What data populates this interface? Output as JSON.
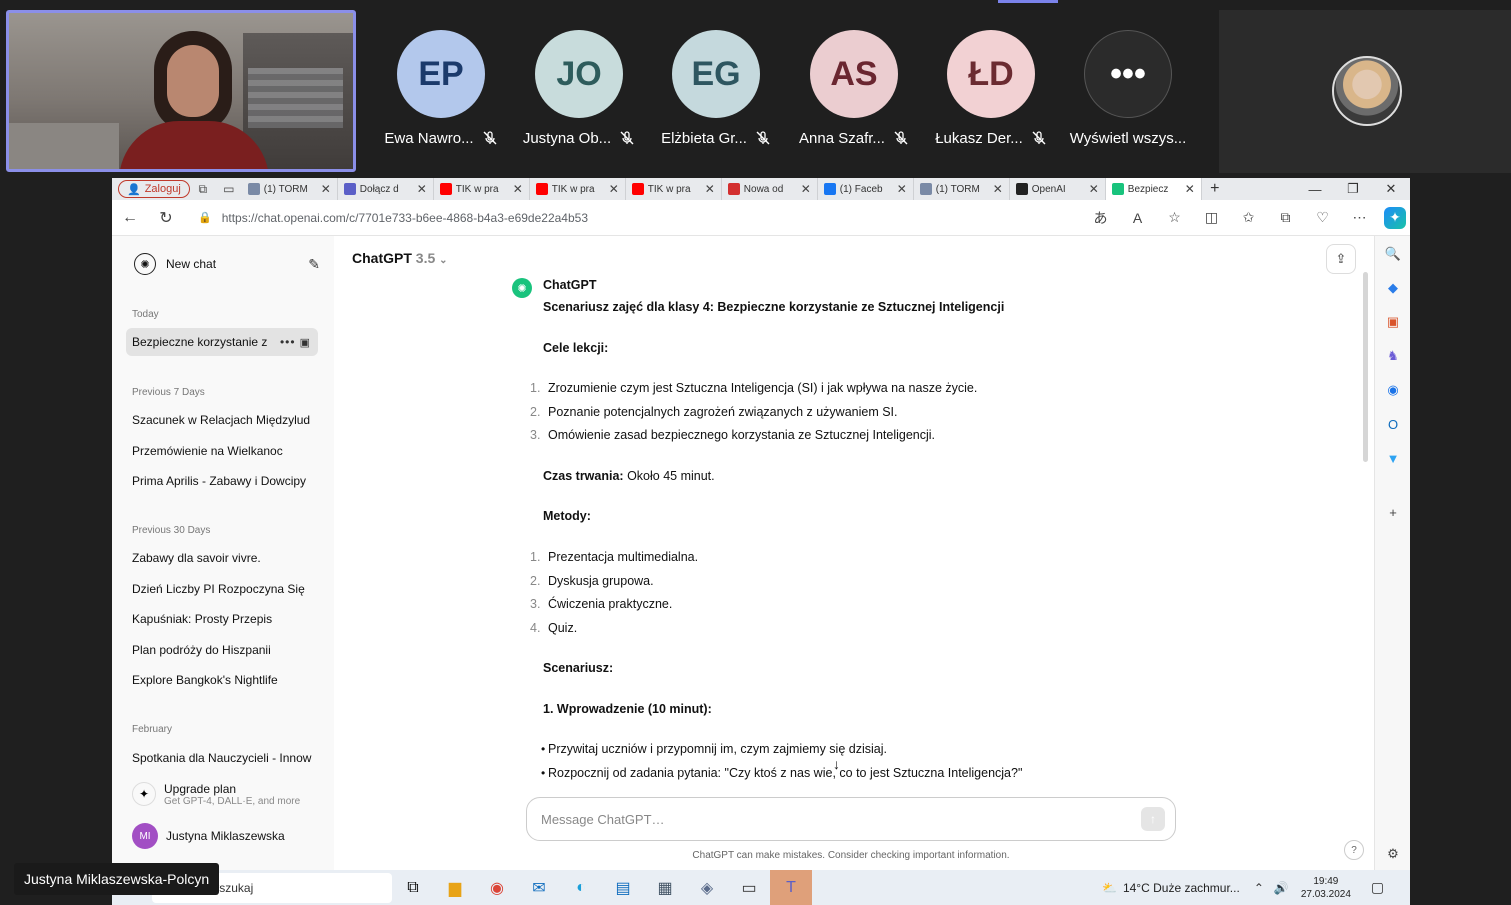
{
  "meeting": {
    "participants": [
      {
        "initials": "EP",
        "name": "Ewa Nawro...",
        "bg": "#b3c8ec",
        "fg": "#1b3a6b"
      },
      {
        "initials": "JO",
        "name": "Justyna Ob...",
        "bg": "#c8dcdc",
        "fg": "#2e5c5c"
      },
      {
        "initials": "EG",
        "name": "Elżbieta Gr...",
        "bg": "#c5d9dd",
        "fg": "#2e5660"
      },
      {
        "initials": "AS",
        "name": "Anna Szafr...",
        "bg": "#ebcdd0",
        "fg": "#6a2630"
      },
      {
        "initials": "ŁD",
        "name": "Łukasz Der...",
        "bg": "#f2d1d3",
        "fg": "#6b2b31"
      },
      {
        "initials": "•••",
        "name": "Wyświetl wszys...",
        "bg": "#2b2b2b",
        "fg": "#ffffff"
      }
    ],
    "presenter_name": "Justyna Miklaszewska-Polcyn"
  },
  "browser": {
    "login_label": "Zaloguj",
    "tabs": [
      {
        "title": "(1) TORM",
        "color": "#7a8aa6"
      },
      {
        "title": "Dołącz d",
        "color": "#5b5fc7"
      },
      {
        "title": "TIK w pra",
        "color": "#ff0000"
      },
      {
        "title": "TIK w pra",
        "color": "#ff0000"
      },
      {
        "title": "TIK w pra",
        "color": "#ff0000"
      },
      {
        "title": "Nowa od",
        "color": "#d32f2f"
      },
      {
        "title": "(1) Faceb",
        "color": "#1877f2"
      },
      {
        "title": "(1) TORM",
        "color": "#7a8aa6"
      },
      {
        "title": "OpenAI",
        "color": "#222222"
      },
      {
        "title": "Bezpiecz",
        "color": "#19c37d"
      }
    ],
    "url": "https://chat.openai.com/c/7701e733-b6ee-4868-b4a3-e69de22a4b53"
  },
  "sidebar": {
    "new_chat": "New chat",
    "today_label": "Today",
    "today_items": [
      "Bezpieczne korzystanie z"
    ],
    "prev7_label": "Previous 7 Days",
    "prev7_items": [
      "Szacunek w Relacjach Międzylud",
      "Przemówienie na Wielkanoc",
      "Prima Aprilis - Zabawy i Dowcipy"
    ],
    "prev30_label": "Previous 30 Days",
    "prev30_items": [
      "Zabawy dla savoir vivre.",
      "Dzień Liczby PI Rozpoczyna Się",
      "Kapuśniak: Prosty Przepis",
      "Plan podróży do Hiszpanii",
      "Explore Bangkok's Nightlife"
    ],
    "feb_label": "February",
    "feb_items": [
      "Spotkania dla Nauczycieli - Innow"
    ],
    "upgrade_title": "Upgrade plan",
    "upgrade_sub": "Get GPT-4, DALL·E, and more",
    "user_initials": "MI",
    "user_name": "Justyna Miklaszewska"
  },
  "chat": {
    "model": "ChatGPT",
    "model_version": "3.5",
    "sender": "ChatGPT",
    "title": "Scenariusz zajęć dla klasy 4: Bezpieczne korzystanie ze Sztucznej Inteligencji",
    "goals_heading": "Cele lekcji:",
    "goals": [
      "Zrozumienie czym jest Sztuczna Inteligencja (SI) i jak wpływa na nasze życie.",
      "Poznanie potencjalnych zagrożeń związanych z używaniem SI.",
      "Omówienie zasad bezpiecznego korzystania ze Sztucznej Inteligencji."
    ],
    "duration_label": "Czas trwania:",
    "duration_value": " Około 45 minut.",
    "methods_heading": "Metody:",
    "methods": [
      "Prezentacja multimedialna.",
      "Dyskusja grupowa.",
      "Ćwiczenia praktyczne.",
      "Quiz."
    ],
    "scenario_heading": "Scenariusz:",
    "intro_heading": "1. Wprowadzenie (10 minut):",
    "intro_items": [
      "Przywitaj uczniów i przypomnij im, czym zajmiemy się dzisiaj.",
      "Rozpocznij od zadania pytania: \"Czy ktoś z nas wie, co to jest Sztuczna Inteligencja?\""
    ],
    "input_placeholder": "Message ChatGPT…",
    "disclaimer": "ChatGPT can make mistakes. Consider checking important information.",
    "help": "?"
  },
  "taskbar": {
    "search_label": "Wyszukaj",
    "weather": "14°C  Duże zachmur...",
    "time": "19:49",
    "date": "27.03.2024"
  }
}
